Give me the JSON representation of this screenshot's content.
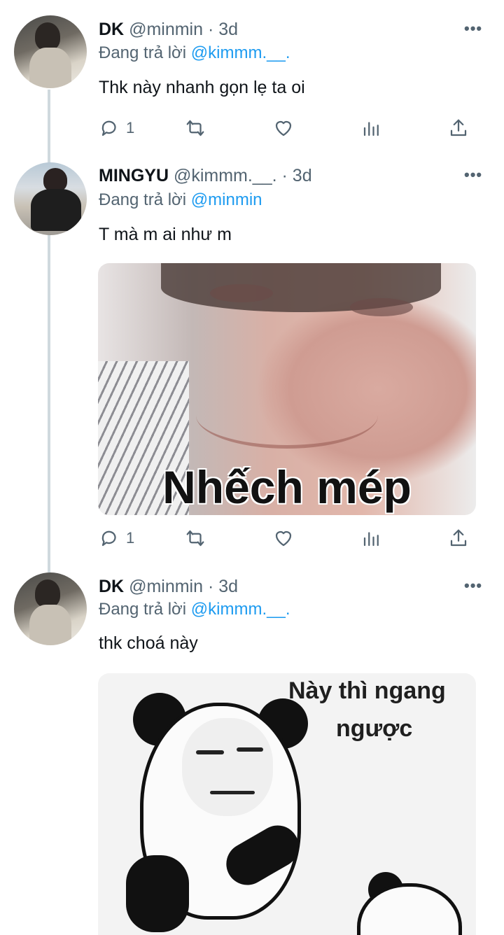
{
  "tweets": [
    {
      "name": "DK",
      "handle": "@minmin",
      "separator": "·",
      "time": "3d",
      "reply_prefix": "Đang trả lời",
      "reply_to": "@kimmm.__.",
      "text": "Thk này nhanh gọn lẹ ta oi",
      "reply_count": "1"
    },
    {
      "name": "MINGYU",
      "handle": "@kimmm.__.",
      "separator": "·",
      "time": "3d",
      "reply_prefix": "Đang trả lời",
      "reply_to": "@minmin",
      "text": "T mà m ai như m",
      "reply_count": "1",
      "media_caption": "Nhếch mép"
    },
    {
      "name": "DK",
      "handle": "@minmin",
      "separator": "·",
      "time": "3d",
      "reply_prefix": "Đang trả lời",
      "reply_to": "@kimmm.__.",
      "text": "thk choá này",
      "media_caption_line1": "Này thì ngang",
      "media_caption_line2": "ngược"
    }
  ],
  "icons": {
    "more": "more-icon",
    "reply": "reply-icon",
    "retweet": "retweet-icon",
    "like": "heart-icon",
    "analytics": "analytics-icon",
    "share": "share-icon"
  },
  "colors": {
    "link": "#1d9bf0",
    "secondary_text": "#536471",
    "thread_line": "#cfd9de"
  }
}
